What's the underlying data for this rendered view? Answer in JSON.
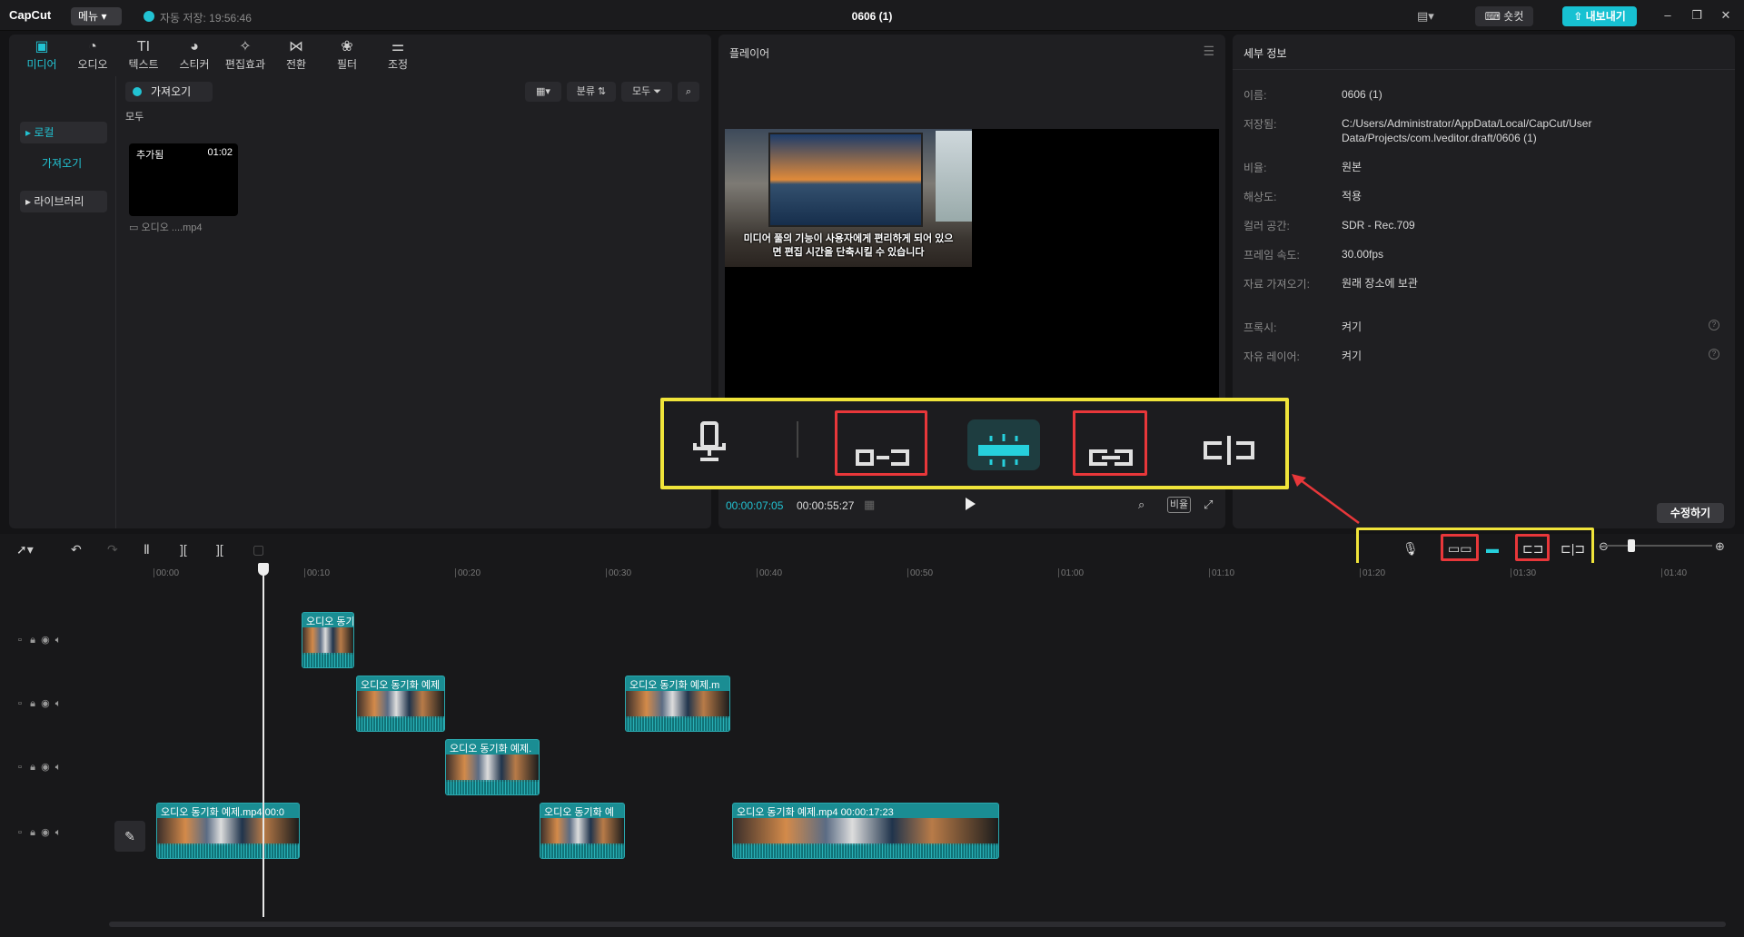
{
  "titlebar": {
    "logo": "CapCut",
    "menu_label": "메뉴",
    "autosave_text": "자동 저장: 19:56:46",
    "project_title": "0606 (1)",
    "shortcut_label": "숏컷",
    "export_label": "내보내기"
  },
  "tools": [
    {
      "label": "미디어",
      "icon": "media-icon"
    },
    {
      "label": "오디오",
      "icon": "audio-icon"
    },
    {
      "label": "텍스트",
      "icon": "text-icon"
    },
    {
      "label": "스티커",
      "icon": "sticker-icon"
    },
    {
      "label": "편집효과",
      "icon": "effects-icon"
    },
    {
      "label": "전환",
      "icon": "transition-icon"
    },
    {
      "label": "필터",
      "icon": "filter-icon"
    },
    {
      "label": "조정",
      "icon": "adjust-icon"
    }
  ],
  "media_sidebar": {
    "local": "로컬",
    "import": "가져오기",
    "library": "라이브러리"
  },
  "media_main": {
    "import_label": "가져오기",
    "sort_label": "분류",
    "filter_label": "모두",
    "section_all": "모두",
    "thumb_added": "추가됨",
    "thumb_duration": "01:02",
    "thumb_name": "오디오 ....mp4"
  },
  "player": {
    "title": "플레이어",
    "caption_line1": "미디어 풀의 기능이 사용자에게 편리하게 되어 있으",
    "caption_line2": "면 편집 시간을 단축시킬 수 있습니다",
    "time_current": "00:00:07:05",
    "time_total": "00:00:55:27",
    "ratio_label": "비율"
  },
  "details": {
    "title": "세부 정보",
    "rows": [
      {
        "label": "이름:",
        "value": "0606 (1)"
      },
      {
        "label": "저장됨:",
        "value": "C:/Users/Administrator/AppData/Local/CapCut/User Data/Projects/com.lveditor.draft/0606 (1)"
      },
      {
        "label": "비율:",
        "value": "원본"
      },
      {
        "label": "해상도:",
        "value": "적용"
      },
      {
        "label": "컬러 공간:",
        "value": "SDR - Rec.709"
      },
      {
        "label": "프레임 속도:",
        "value": "30.00fps"
      },
      {
        "label": "자료 가져오기:",
        "value": "원래 장소에 보관"
      },
      {
        "label": "프록시:",
        "value": "켜기"
      },
      {
        "label": "자유 레이어:",
        "value": "켜기"
      }
    ],
    "edit_label": "수정하기"
  },
  "ruler_ticks": [
    "00:00",
    "00:10",
    "00:20",
    "00:30",
    "00:40",
    "00:50",
    "01:00",
    "01:10",
    "01:20",
    "01:30",
    "01:40"
  ],
  "clips": [
    {
      "label": "오디오 동기"
    },
    {
      "label": "오디오 동기화 예제"
    },
    {
      "label": "오디오 동기화 예제.m"
    },
    {
      "label": "오디오 동기화 예제."
    },
    {
      "label": "오디오 동기화 예제.mp4  00:0"
    },
    {
      "label": "오디오 동기화 예"
    },
    {
      "label": "오디오 동기화 예제.mp4  00:00:17:23"
    }
  ]
}
